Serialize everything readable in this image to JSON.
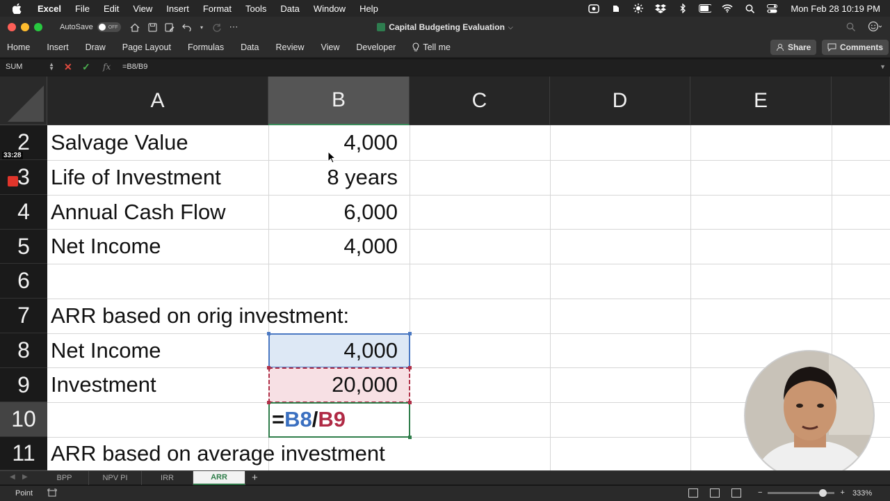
{
  "menubar": {
    "app": "Excel",
    "items": [
      "File",
      "Edit",
      "View",
      "Insert",
      "Format",
      "Tools",
      "Data",
      "Window",
      "Help"
    ],
    "clock": "Mon Feb 28  10:19 PM"
  },
  "titlebar": {
    "autosave_label": "AutoSave",
    "autosave_state": "OFF",
    "document_title": "Capital Budgeting Evaluation"
  },
  "ribbon": {
    "tabs": [
      "Home",
      "Insert",
      "Draw",
      "Page Layout",
      "Formulas",
      "Data",
      "Review",
      "View",
      "Developer"
    ],
    "tell_me": "Tell me",
    "share": "Share",
    "comments": "Comments"
  },
  "formula_bar": {
    "name_box": "SUM",
    "formula": "=B8/B9"
  },
  "columns": [
    "A",
    "B",
    "C",
    "D",
    "E"
  ],
  "rows": [
    {
      "num": "2",
      "a": "Salvage Value",
      "b": "4,000"
    },
    {
      "num": "3",
      "a": "Life of Investment",
      "b": "8 years"
    },
    {
      "num": "4",
      "a": "Annual Cash Flow",
      "b": "6,000"
    },
    {
      "num": "5",
      "a": "Net Income",
      "b": "4,000"
    },
    {
      "num": "6",
      "a": "",
      "b": ""
    },
    {
      "num": "7",
      "a": "ARR based on orig investment:",
      "b": ""
    },
    {
      "num": "8",
      "a": "Net Income",
      "b": "4,000"
    },
    {
      "num": "9",
      "a": "Investment",
      "b": "20,000"
    },
    {
      "num": "10",
      "a": "",
      "b": ""
    },
    {
      "num": "11",
      "a": "ARR based on average investment",
      "b": ""
    }
  ],
  "editing_cell": {
    "prefix": "=",
    "ref1": "B8",
    "operator": "/",
    "ref2": "B9"
  },
  "recording": {
    "elapsed": "33:28"
  },
  "sheet_tabs": [
    "BPP",
    "NPV PI",
    "IRR",
    "ARR"
  ],
  "active_sheet": "ARR",
  "status": {
    "mode": "Point",
    "zoom": "333%"
  },
  "colors": {
    "excel_green": "#2f7d4a",
    "ref_blue": "#3a6fc0",
    "ref_red": "#b02a45"
  }
}
